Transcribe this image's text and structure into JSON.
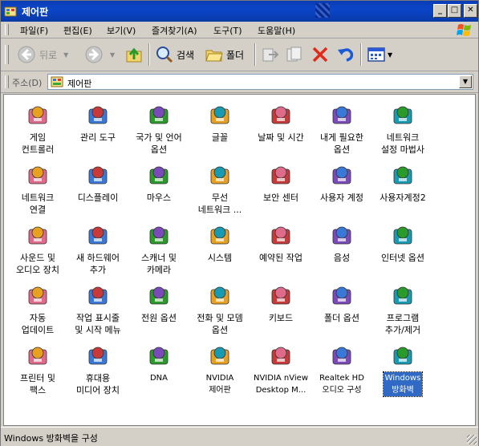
{
  "window": {
    "title": "제어판"
  },
  "menu": [
    "파일(F)",
    "편집(E)",
    "보기(V)",
    "즐겨찾기(A)",
    "도구(T)",
    "도움말(H)"
  ],
  "toolbar": {
    "back_label": "뒤로",
    "search_label": "검색",
    "folders_label": "폴더"
  },
  "address": {
    "label": "주소(D)",
    "value": "제어판"
  },
  "items": [
    {
      "label": "게임\n컨트롤러",
      "icon": "game-controller-icon"
    },
    {
      "label": "관리 도구",
      "icon": "admin-tools-icon"
    },
    {
      "label": "국가 및 언어\n옵션",
      "icon": "regional-options-icon"
    },
    {
      "label": "글꼴",
      "icon": "fonts-icon"
    },
    {
      "label": "날짜 및 시간",
      "icon": "date-time-icon"
    },
    {
      "label": "내게 필요한\n옵션",
      "icon": "accessibility-icon"
    },
    {
      "label": "네트워크\n설정 마법사",
      "icon": "network-setup-icon"
    },
    {
      "label": "네트워크\n연결",
      "icon": "network-connections-icon"
    },
    {
      "label": "디스플레이",
      "icon": "display-icon"
    },
    {
      "label": "마우스",
      "icon": "mouse-icon"
    },
    {
      "label": "무선\n네트워크 ...",
      "icon": "wireless-network-icon"
    },
    {
      "label": "보안 센터",
      "icon": "security-center-icon"
    },
    {
      "label": "사용자 계정",
      "icon": "user-accounts-icon"
    },
    {
      "label": "사용자계정2",
      "icon": "user-accounts2-icon"
    },
    {
      "label": "사운드 및\n오디오 장치",
      "icon": "sound-icon"
    },
    {
      "label": "새 하드웨어\n추가",
      "icon": "add-hardware-icon"
    },
    {
      "label": "스캐너 및\n카메라",
      "icon": "scanner-camera-icon"
    },
    {
      "label": "시스템",
      "icon": "system-icon"
    },
    {
      "label": "예약된 작업",
      "icon": "scheduled-tasks-icon"
    },
    {
      "label": "음성",
      "icon": "speech-icon"
    },
    {
      "label": "인터넷 옵션",
      "icon": "internet-options-icon"
    },
    {
      "label": "자동\n업데이트",
      "icon": "automatic-updates-icon"
    },
    {
      "label": "작업 표시줄\n및 시작 메뉴",
      "icon": "taskbar-icon"
    },
    {
      "label": "전원 옵션",
      "icon": "power-options-icon"
    },
    {
      "label": "전화 및 모뎀\n옵션",
      "icon": "phone-modem-icon"
    },
    {
      "label": "키보드",
      "icon": "keyboard-icon"
    },
    {
      "label": "폴더 옵션",
      "icon": "folder-options-icon"
    },
    {
      "label": "프로그램\n추가/제거",
      "icon": "add-remove-programs-icon"
    },
    {
      "label": "프린터 및\n팩스",
      "icon": "printers-fax-icon"
    },
    {
      "label": "휴대용\n미디어 장치",
      "icon": "portable-media-icon"
    },
    {
      "label": "DNA",
      "icon": "dna-icon"
    },
    {
      "label": "NVIDIA\n제어판",
      "icon": "nvidia-control-panel-icon"
    },
    {
      "label": "NVIDIA nView\nDesktop M...",
      "icon": "nvidia-nview-icon"
    },
    {
      "label": "Realtek HD\n오디오 구성",
      "icon": "realtek-audio-icon"
    },
    {
      "label": "Windows\n방화벽",
      "icon": "windows-firewall-icon"
    }
  ],
  "status": {
    "text": "Windows 방화벽을 구성"
  }
}
